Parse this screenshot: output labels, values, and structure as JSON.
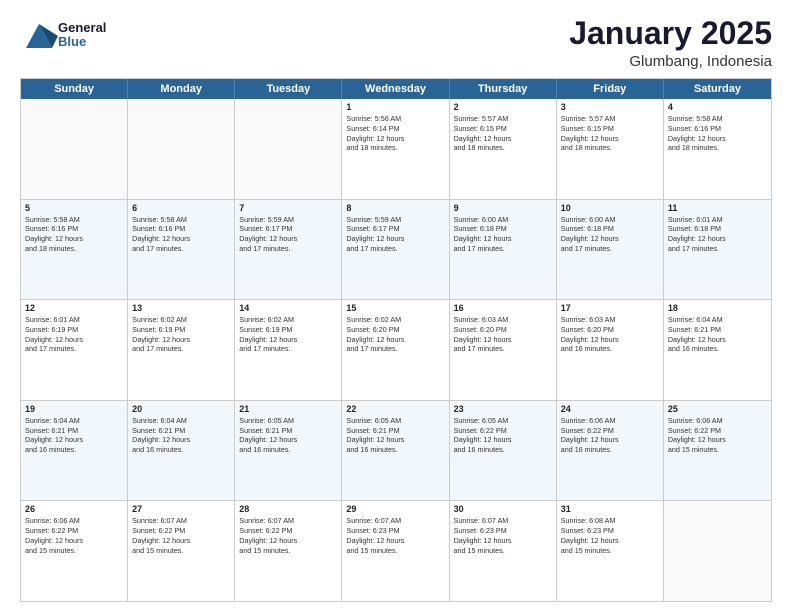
{
  "header": {
    "logo_text1": "General",
    "logo_text2": "Blue",
    "month": "January 2025",
    "location": "Glumbang, Indonesia"
  },
  "weekdays": [
    "Sunday",
    "Monday",
    "Tuesday",
    "Wednesday",
    "Thursday",
    "Friday",
    "Saturday"
  ],
  "weeks": [
    [
      {
        "day": "",
        "info": ""
      },
      {
        "day": "",
        "info": ""
      },
      {
        "day": "",
        "info": ""
      },
      {
        "day": "1",
        "info": "Sunrise: 5:56 AM\nSunset: 6:14 PM\nDaylight: 12 hours\nand 18 minutes."
      },
      {
        "day": "2",
        "info": "Sunrise: 5:57 AM\nSunset: 6:15 PM\nDaylight: 12 hours\nand 18 minutes."
      },
      {
        "day": "3",
        "info": "Sunrise: 5:57 AM\nSunset: 6:15 PM\nDaylight: 12 hours\nand 18 minutes."
      },
      {
        "day": "4",
        "info": "Sunrise: 5:58 AM\nSunset: 6:16 PM\nDaylight: 12 hours\nand 18 minutes."
      }
    ],
    [
      {
        "day": "5",
        "info": "Sunrise: 5:58 AM\nSunset: 6:16 PM\nDaylight: 12 hours\nand 18 minutes."
      },
      {
        "day": "6",
        "info": "Sunrise: 5:58 AM\nSunset: 6:16 PM\nDaylight: 12 hours\nand 17 minutes."
      },
      {
        "day": "7",
        "info": "Sunrise: 5:59 AM\nSunset: 6:17 PM\nDaylight: 12 hours\nand 17 minutes."
      },
      {
        "day": "8",
        "info": "Sunrise: 5:59 AM\nSunset: 6:17 PM\nDaylight: 12 hours\nand 17 minutes."
      },
      {
        "day": "9",
        "info": "Sunrise: 6:00 AM\nSunset: 6:18 PM\nDaylight: 12 hours\nand 17 minutes."
      },
      {
        "day": "10",
        "info": "Sunrise: 6:00 AM\nSunset: 6:18 PM\nDaylight: 12 hours\nand 17 minutes."
      },
      {
        "day": "11",
        "info": "Sunrise: 6:01 AM\nSunset: 6:18 PM\nDaylight: 12 hours\nand 17 minutes."
      }
    ],
    [
      {
        "day": "12",
        "info": "Sunrise: 6:01 AM\nSunset: 6:19 PM\nDaylight: 12 hours\nand 17 minutes."
      },
      {
        "day": "13",
        "info": "Sunrise: 6:02 AM\nSunset: 6:19 PM\nDaylight: 12 hours\nand 17 minutes."
      },
      {
        "day": "14",
        "info": "Sunrise: 6:02 AM\nSunset: 6:19 PM\nDaylight: 12 hours\nand 17 minutes."
      },
      {
        "day": "15",
        "info": "Sunrise: 6:02 AM\nSunset: 6:20 PM\nDaylight: 12 hours\nand 17 minutes."
      },
      {
        "day": "16",
        "info": "Sunrise: 6:03 AM\nSunset: 6:20 PM\nDaylight: 12 hours\nand 17 minutes."
      },
      {
        "day": "17",
        "info": "Sunrise: 6:03 AM\nSunset: 6:20 PM\nDaylight: 12 hours\nand 16 minutes."
      },
      {
        "day": "18",
        "info": "Sunrise: 6:04 AM\nSunset: 6:21 PM\nDaylight: 12 hours\nand 16 minutes."
      }
    ],
    [
      {
        "day": "19",
        "info": "Sunrise: 6:04 AM\nSunset: 6:21 PM\nDaylight: 12 hours\nand 16 minutes."
      },
      {
        "day": "20",
        "info": "Sunrise: 6:04 AM\nSunset: 6:21 PM\nDaylight: 12 hours\nand 16 minutes."
      },
      {
        "day": "21",
        "info": "Sunrise: 6:05 AM\nSunset: 6:21 PM\nDaylight: 12 hours\nand 16 minutes."
      },
      {
        "day": "22",
        "info": "Sunrise: 6:05 AM\nSunset: 6:21 PM\nDaylight: 12 hours\nand 16 minutes."
      },
      {
        "day": "23",
        "info": "Sunrise: 6:05 AM\nSunset: 6:22 PM\nDaylight: 12 hours\nand 16 minutes."
      },
      {
        "day": "24",
        "info": "Sunrise: 6:06 AM\nSunset: 6:22 PM\nDaylight: 12 hours\nand 16 minutes."
      },
      {
        "day": "25",
        "info": "Sunrise: 6:06 AM\nSunset: 6:22 PM\nDaylight: 12 hours\nand 15 minutes."
      }
    ],
    [
      {
        "day": "26",
        "info": "Sunrise: 6:06 AM\nSunset: 6:22 PM\nDaylight: 12 hours\nand 15 minutes."
      },
      {
        "day": "27",
        "info": "Sunrise: 6:07 AM\nSunset: 6:22 PM\nDaylight: 12 hours\nand 15 minutes."
      },
      {
        "day": "28",
        "info": "Sunrise: 6:07 AM\nSunset: 6:22 PM\nDaylight: 12 hours\nand 15 minutes."
      },
      {
        "day": "29",
        "info": "Sunrise: 6:07 AM\nSunset: 6:23 PM\nDaylight: 12 hours\nand 15 minutes."
      },
      {
        "day": "30",
        "info": "Sunrise: 6:07 AM\nSunset: 6:23 PM\nDaylight: 12 hours\nand 15 minutes."
      },
      {
        "day": "31",
        "info": "Sunrise: 6:08 AM\nSunset: 6:23 PM\nDaylight: 12 hours\nand 15 minutes."
      },
      {
        "day": "",
        "info": ""
      }
    ]
  ]
}
